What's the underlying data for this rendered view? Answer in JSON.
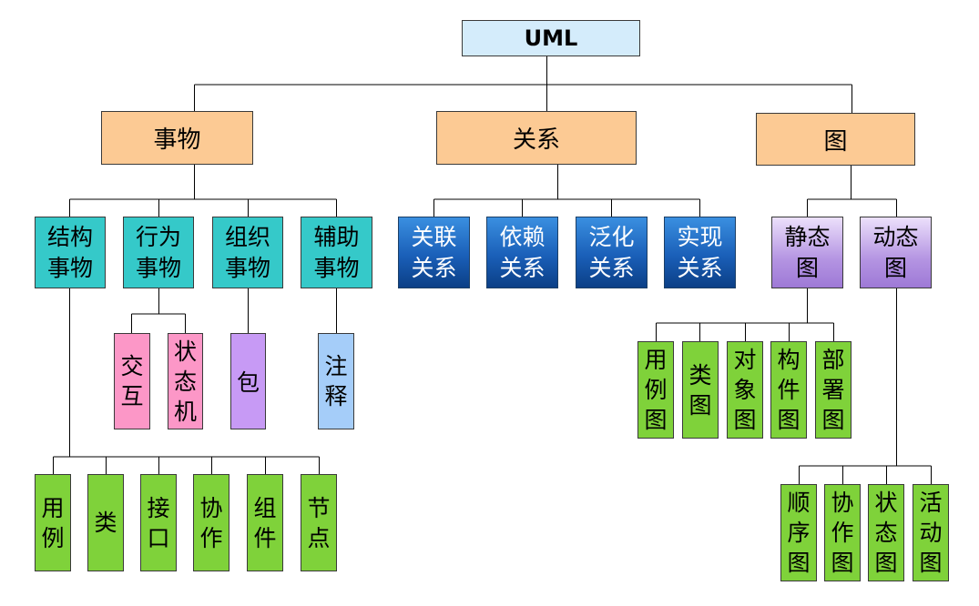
{
  "root": "UML",
  "categories": {
    "things": "事物",
    "relations": "关系",
    "diagrams": "图"
  },
  "things": {
    "structural": "结构事物",
    "behavioral": "行为事物",
    "grouping": "组织事物",
    "annotational": "辅助事物"
  },
  "behavioral_children": {
    "interaction": "交互",
    "state_machine": "状态机"
  },
  "grouping_children": {
    "package": "包"
  },
  "annotational_children": {
    "note": "注释"
  },
  "structural_children": {
    "use_case": "用例",
    "class": "类",
    "interface": "接口",
    "collaboration": "协作",
    "component": "组件",
    "node": "节点"
  },
  "relations": {
    "association": "关联关系",
    "dependency": "依赖关系",
    "generalization": "泛化关系",
    "realization": "实现关系"
  },
  "diagram_types": {
    "static": "静态图",
    "dynamic": "动态图"
  },
  "static_diagrams": {
    "use_case": "用例图",
    "class": "类图",
    "object": "对象图",
    "component": "构件图",
    "deployment": "部署图"
  },
  "dynamic_diagrams": {
    "sequence": "顺序图",
    "collaboration": "协作图",
    "state": "状态图",
    "activity": "活动图"
  }
}
